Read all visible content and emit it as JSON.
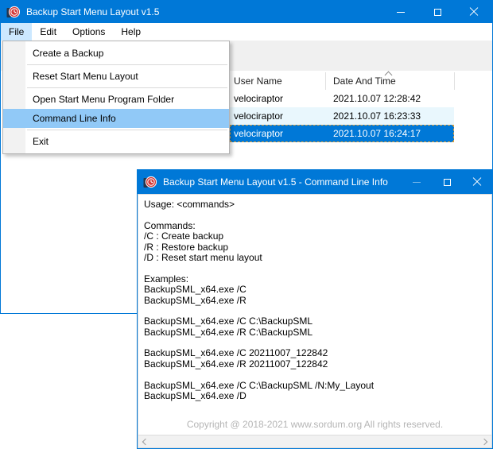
{
  "main_window": {
    "title": "Backup Start Menu Layout v1.5",
    "menubar": {
      "items": [
        {
          "label": "File"
        },
        {
          "label": "Edit"
        },
        {
          "label": "Options"
        },
        {
          "label": "Help"
        }
      ]
    },
    "file_menu": {
      "items": [
        {
          "label": "Create a Backup"
        },
        {
          "label": "Reset Start Menu Layout"
        },
        {
          "label": "Open Start Menu Program Folder"
        },
        {
          "label": "Command Line Info",
          "highlighted": true
        },
        {
          "label": "Exit"
        }
      ]
    },
    "list": {
      "columns": [
        {
          "label": "User Name"
        },
        {
          "label": "Date And Time",
          "sort": "ascending"
        }
      ],
      "rows": [
        {
          "user": "velociraptor",
          "datetime": "2021.10.07 12:28:42"
        },
        {
          "user": "velociraptor",
          "datetime": "2021.10.07 16:23:33"
        },
        {
          "user": "velociraptor",
          "datetime": "2021.10.07 16:24:17",
          "selected": true
        }
      ]
    }
  },
  "dialog": {
    "title": "Backup Start Menu Layout v1.5 - Command Line Info",
    "lines": [
      "Usage: <commands>",
      "",
      "Commands:",
      "/C : Create backup",
      "/R : Restore backup",
      "/D : Reset start menu layout",
      "",
      "Examples:",
      "BackupSML_x64.exe /C",
      "BackupSML_x64.exe /R",
      "",
      "BackupSML_x64.exe /C C:\\BackupSML",
      "BackupSML_x64.exe /R C:\\BackupSML",
      "",
      "BackupSML_x64.exe /C 20211007_122842",
      "BackupSML_x64.exe /R 20211007_122842",
      "",
      "BackupSML_x64.exe /C C:\\BackupSML /N:My_Layout",
      "BackupSML_x64.exe /D"
    ],
    "copyright": "Copyright @ 2018-2021 www.sordum.org All rights reserved."
  },
  "colors": {
    "titlebar": "#0078d7",
    "selection": "#0078d7",
    "menu_highlight": "#91c9f7",
    "menubar_item_active": "#cce8ff",
    "row_alt": "#e9f7fd",
    "focus_dashed": "#e2a23c"
  }
}
